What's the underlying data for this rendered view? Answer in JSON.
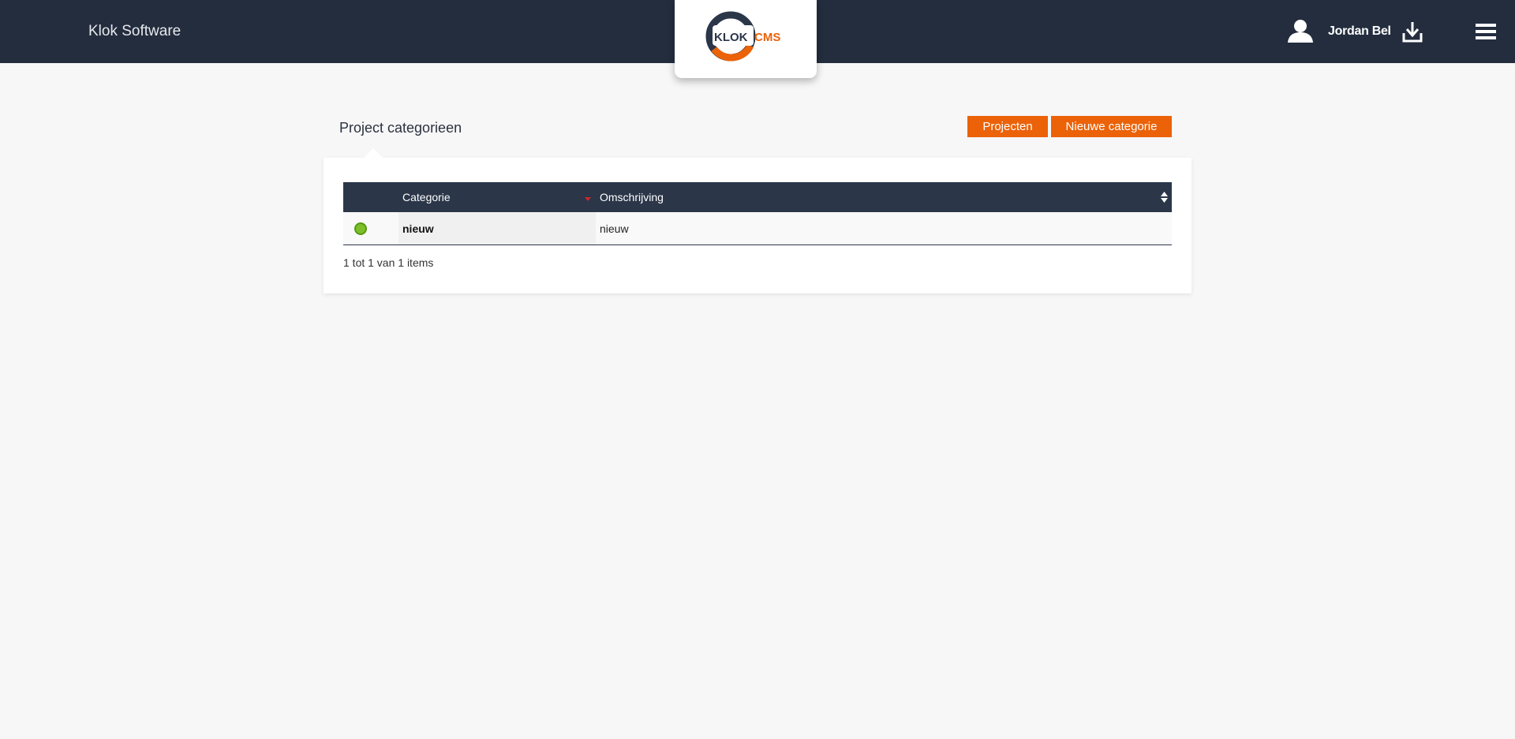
{
  "header": {
    "brand": "Klok Software",
    "logo": {
      "word1": "KLOK",
      "word2": "CMS",
      "color_dark": "#2b3649",
      "color_accent": "#eb6209"
    },
    "user_name": "Jordan Bel",
    "icons": {
      "user": "user-icon",
      "download": "download-icon",
      "menu": "hamburger-menu-icon"
    }
  },
  "page": {
    "title": "Project categorieen",
    "buttons": {
      "projecten": "Projecten",
      "nieuwe_categorie": "Nieuwe categorie"
    }
  },
  "table": {
    "columns": [
      "Categorie",
      "Omschrijving"
    ],
    "rows": [
      {
        "status": "active",
        "status_color": "#7cbf28",
        "categorie": "nieuw",
        "omschrijving": "nieuw"
      }
    ],
    "pager": "1 tot 1 van 1 items"
  },
  "colors": {
    "header_bg": "#232d3e",
    "accent": "#eb6209",
    "table_header": "#2b3649"
  }
}
